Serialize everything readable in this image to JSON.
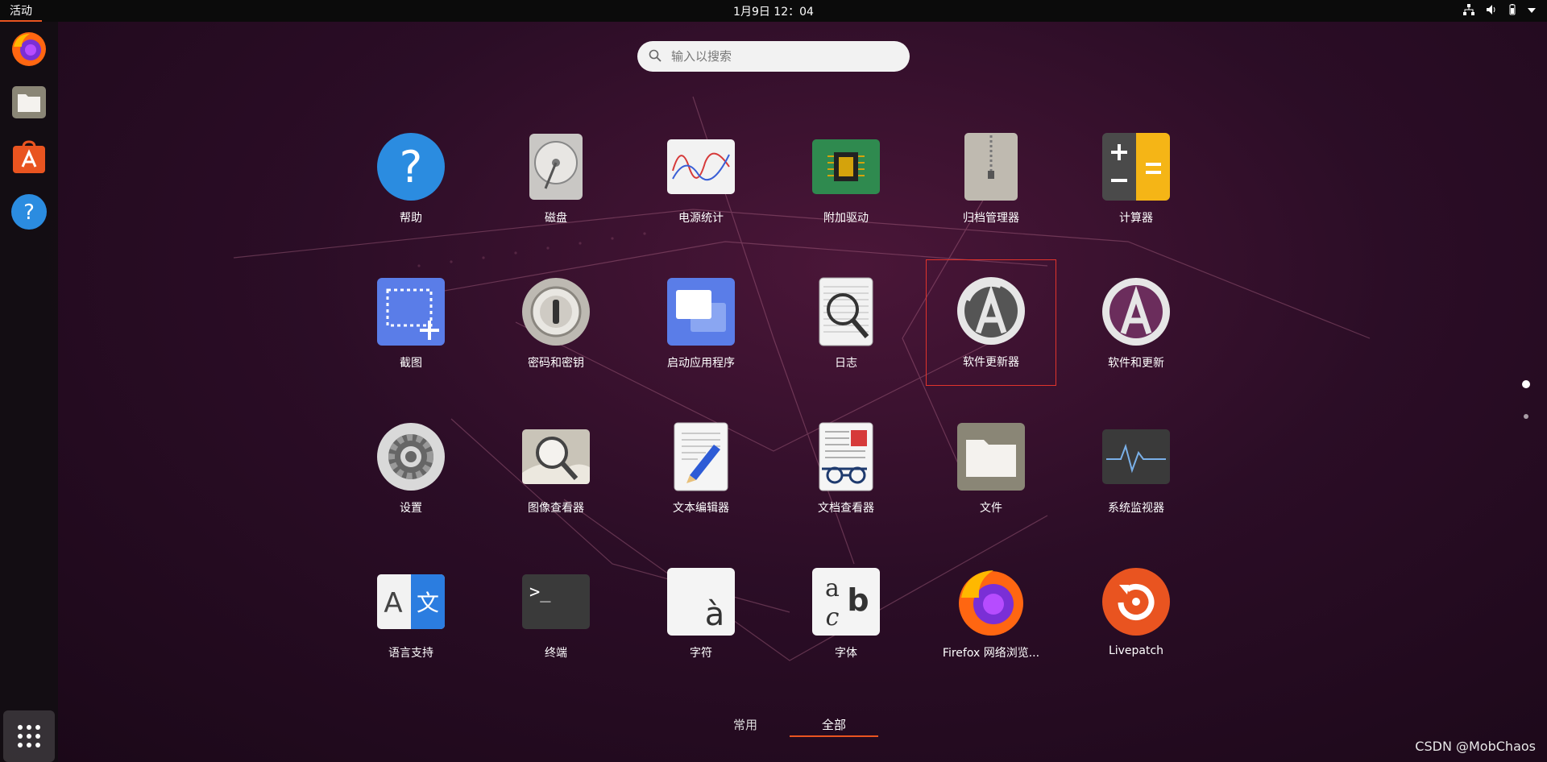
{
  "topbar": {
    "activities": "活动",
    "clock": "1月9日  12：04"
  },
  "search": {
    "placeholder": "输入以搜索"
  },
  "apps": [
    {
      "label": "帮助",
      "icon": "help-icon"
    },
    {
      "label": "磁盘",
      "icon": "disk-icon"
    },
    {
      "label": "电源统计",
      "icon": "power-statistics-icon"
    },
    {
      "label": "附加驱动",
      "icon": "additional-drivers-icon"
    },
    {
      "label": "归档管理器",
      "icon": "archive-manager-icon"
    },
    {
      "label": "计算器",
      "icon": "calculator-icon"
    },
    {
      "label": "截图",
      "icon": "screenshot-icon"
    },
    {
      "label": "密码和密钥",
      "icon": "passwords-keys-icon"
    },
    {
      "label": "启动应用程序",
      "icon": "startup-applications-icon"
    },
    {
      "label": "日志",
      "icon": "logs-icon"
    },
    {
      "label": "软件更新器",
      "icon": "software-updater-icon"
    },
    {
      "label": "软件和更新",
      "icon": "software-updates-icon"
    },
    {
      "label": "设置",
      "icon": "settings-icon"
    },
    {
      "label": "图像查看器",
      "icon": "image-viewer-icon"
    },
    {
      "label": "文本编辑器",
      "icon": "text-editor-icon"
    },
    {
      "label": "文档查看器",
      "icon": "document-viewer-icon"
    },
    {
      "label": "文件",
      "icon": "files-icon"
    },
    {
      "label": "系统监视器",
      "icon": "system-monitor-icon"
    },
    {
      "label": "语言支持",
      "icon": "language-support-icon"
    },
    {
      "label": "终端",
      "icon": "terminal-icon"
    },
    {
      "label": "字符",
      "icon": "characters-icon"
    },
    {
      "label": "字体",
      "icon": "fonts-icon"
    },
    {
      "label": "Firefox 网络浏览...",
      "icon": "firefox-icon"
    },
    {
      "label": "Livepatch",
      "icon": "livepatch-icon"
    }
  ],
  "selected_app": "软件更新器",
  "tabs": {
    "frequent": "常用",
    "all": "全部"
  },
  "watermark": "CSDN @MobChaos",
  "colors": {
    "accent": "#e95420",
    "highlight": "#e0342c"
  }
}
